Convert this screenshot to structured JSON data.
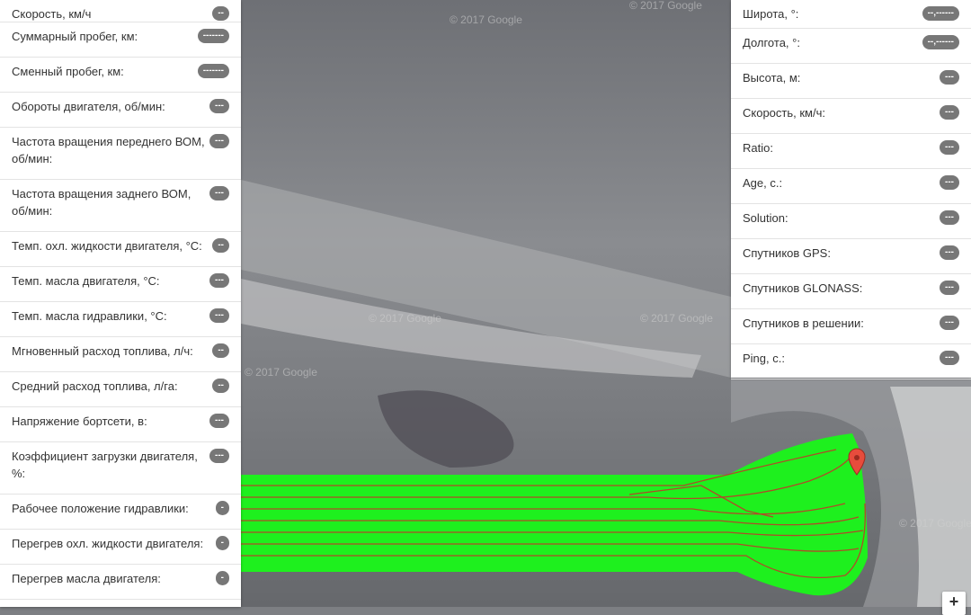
{
  "left_panel": {
    "rows": [
      {
        "label": "Скорость, км/ч",
        "value": "--"
      },
      {
        "label": "Суммарный пробег, км:",
        "value": "-------"
      },
      {
        "label": "Сменный пробег, км:",
        "value": "-------"
      },
      {
        "label": "Обороты двигателя, об/мин:",
        "value": "---"
      },
      {
        "label": "Частота вращения переднего ВОМ, об/мин:",
        "value": "---"
      },
      {
        "label": "Частота вращения заднего ВОМ, об/мин:",
        "value": "---"
      },
      {
        "label": "Темп. охл. жидкости двигателя, °С:",
        "value": "--"
      },
      {
        "label": "Темп. масла двигателя, °С:",
        "value": "---"
      },
      {
        "label": "Темп. масла гидравлики, °С:",
        "value": "---"
      },
      {
        "label": "Мгновенный расход топлива, л/ч:",
        "value": "--"
      },
      {
        "label": "Средний расход топлива, л/га:",
        "value": "--"
      },
      {
        "label": "Напряжение бортсети, в:",
        "value": "---"
      },
      {
        "label": "Коэффициент загрузки двигателя, %:",
        "value": "---"
      },
      {
        "label": "Рабочее положение гидравлики:",
        "value": "-"
      },
      {
        "label": "Перегрев охл. жидкости двигателя:",
        "value": "-"
      },
      {
        "label": "Перегрев масла двигателя:",
        "value": "-"
      }
    ]
  },
  "right_panel": {
    "rows": [
      {
        "label": "Широта, °:",
        "value": "--,------"
      },
      {
        "label": "Долгота, °:",
        "value": "--,------"
      },
      {
        "label": "Высота, м:",
        "value": "---"
      },
      {
        "label": "Скорость, км/ч:",
        "value": "---"
      },
      {
        "label": "Ratio:",
        "value": "---"
      },
      {
        "label": "Age, с.:",
        "value": "---"
      },
      {
        "label": "Solution:",
        "value": "---"
      },
      {
        "label": "Спутников GPS:",
        "value": "---"
      },
      {
        "label": "Спутников GLONASS:",
        "value": "---"
      },
      {
        "label": "Спутников в решении:",
        "value": "---"
      },
      {
        "label": "Ping, с.:",
        "value": "---"
      }
    ]
  },
  "map": {
    "watermark": "© 2017 Google",
    "zoom_in_label": "+",
    "track_color": "#20f020",
    "path_color": "#c0392b",
    "marker_color": "#e74c3c",
    "marker_icon": "map-pin-icon"
  }
}
